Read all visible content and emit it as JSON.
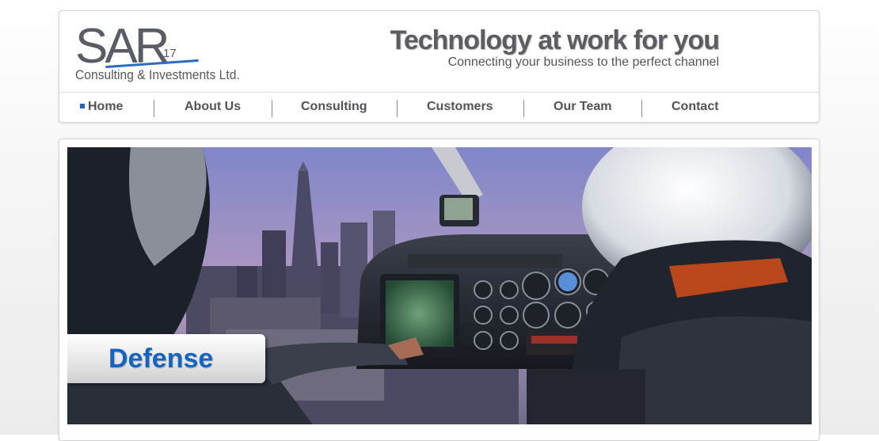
{
  "brand": {
    "logo_text": "SAR",
    "logo_superscript": "17",
    "company_name": "Consulting & Investments Ltd."
  },
  "hero": {
    "title": "Technology at work for you",
    "subtitle": "Connecting your business to the perfect channel"
  },
  "nav": {
    "items": [
      {
        "label": "Home",
        "active": true
      },
      {
        "label": "About Us"
      },
      {
        "label": "Consulting"
      },
      {
        "label": "Customers"
      },
      {
        "label": "Our Team"
      },
      {
        "label": "Contact"
      }
    ]
  },
  "banner": {
    "caption": "Defense",
    "image": "helicopter-cockpit-city-photo"
  },
  "colors": {
    "accent": "#1e64c8",
    "caption_text": "#1565c0",
    "nav_text": "#505357",
    "title_text": "#5b5d62"
  }
}
